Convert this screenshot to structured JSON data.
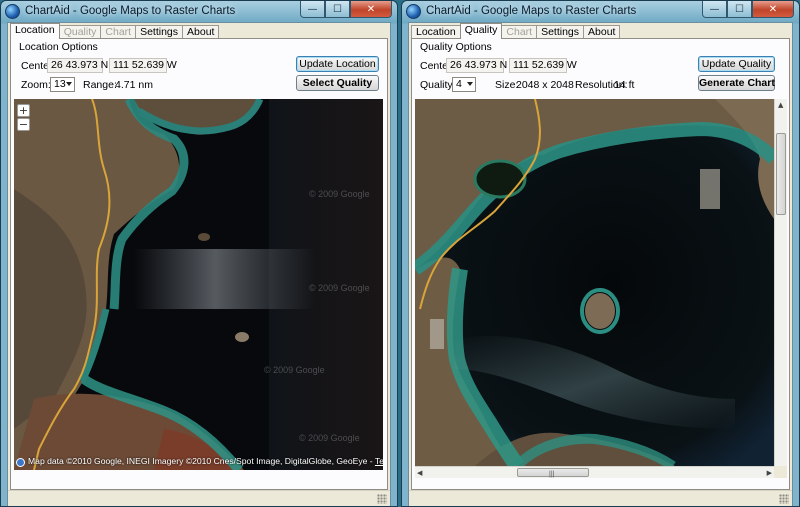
{
  "left_window": {
    "title": "ChartAid - Google Maps to Raster Charts",
    "tabs": [
      {
        "label": "Location",
        "state": "active"
      },
      {
        "label": "Quality",
        "state": "disabled"
      },
      {
        "label": "Chart",
        "state": "disabled"
      },
      {
        "label": "Settings",
        "state": "enabled"
      },
      {
        "label": "About",
        "state": "enabled"
      }
    ],
    "group_title": "Location Options",
    "center_label": "Center:",
    "center_lat": "26 43.973 N",
    "center_lon": "111 52.639 W",
    "zoom_label": "Zoom:",
    "zoom_value": "13",
    "range_label": "Range:",
    "range_value": "4.71 nm",
    "update_button": "Update Location",
    "select_button": "Select Quality",
    "map": {
      "zoom_in": "+",
      "zoom_out": "−",
      "credit": "Map data ©2010 Google, INEGI  Imagery ©2010 Cnes/Spot Image, DigitalGlobe, GeoEye - ",
      "terms": "Terms of Use",
      "watermark": "© 2009 Google"
    }
  },
  "right_window": {
    "title": "ChartAid - Google Maps to Raster Charts",
    "tabs": [
      {
        "label": "Location",
        "state": "enabled"
      },
      {
        "label": "Quality",
        "state": "active"
      },
      {
        "label": "Chart",
        "state": "disabled"
      },
      {
        "label": "Settings",
        "state": "enabled"
      },
      {
        "label": "About",
        "state": "enabled"
      }
    ],
    "group_title": "Quality Options",
    "center_label": "Center:",
    "center_lat": "26 43.973 N",
    "center_lon": "111 52.639 W",
    "quality_label": "Quality:",
    "quality_value": "4",
    "size_label": "Size:",
    "size_value": "2048 x 2048",
    "resolution_label": "Resolution:",
    "resolution_value": "14 ft",
    "update_button": "Update Quality",
    "generate_button": "Generate Chart"
  },
  "window_controls": {
    "minimize": "—",
    "maximize": "☐",
    "close": "✕"
  },
  "colors": {
    "titlebar": "#6ea9c4",
    "water_deep": "#06080b",
    "water_shallow": "#2a8a7c",
    "land": "#6b5a45",
    "road": "#d9a43a"
  }
}
